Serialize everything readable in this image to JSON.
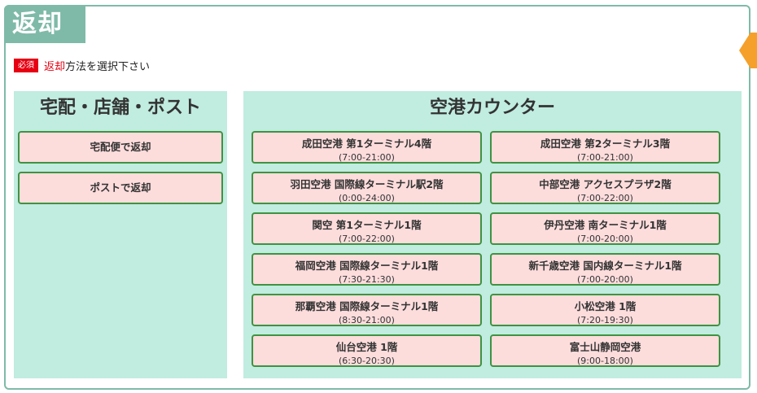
{
  "section": {
    "title": "返却",
    "required_badge": "必須",
    "instruction_accent": "返却",
    "instruction_rest": "方法を選択下さい"
  },
  "delivery_panel": {
    "title": "宅配・店舗・ポスト",
    "buttons": [
      {
        "label": "宅配便で返却"
      },
      {
        "label": "ポストで返却"
      }
    ]
  },
  "airport_panel": {
    "title": "空港カウンター",
    "counters": [
      {
        "name": "成田空港 第1ターミナル4階",
        "hours": "(7:00-21:00)"
      },
      {
        "name": "成田空港 第2ターミナル3階",
        "hours": "(7:00-21:00)"
      },
      {
        "name": "羽田空港 国際線ターミナル駅2階",
        "hours": "(0:00-24:00)"
      },
      {
        "name": "中部空港 アクセスプラザ2階",
        "hours": "(7:00-22:00)"
      },
      {
        "name": "関空 第1ターミナル1階",
        "hours": "(7:00-22:00)"
      },
      {
        "name": "伊丹空港 南ターミナル1階",
        "hours": "(7:00-20:00)"
      },
      {
        "name": "福岡空港 国際線ターミナル1階",
        "hours": "(7:30-21:30)"
      },
      {
        "name": "新千歳空港 国内線ターミナル1階",
        "hours": "(7:00-20:00)"
      },
      {
        "name": "那覇空港 国際線ターミナル1階",
        "hours": "(8:30-21:00)"
      },
      {
        "name": "小松空港 1階",
        "hours": "(7:20-19:30)"
      },
      {
        "name": "仙台空港 1階",
        "hours": "(6:30-20:30)"
      },
      {
        "name": "富士山静岡空港",
        "hours": "(9:00-18:00)"
      }
    ]
  },
  "colors": {
    "frame": "#7fbaa8",
    "panel_bg": "#c1ece0",
    "button_bg": "#fddcdc",
    "button_border": "#3e9341",
    "required_red": "#e60012",
    "side_tab": "#f5a02b"
  }
}
